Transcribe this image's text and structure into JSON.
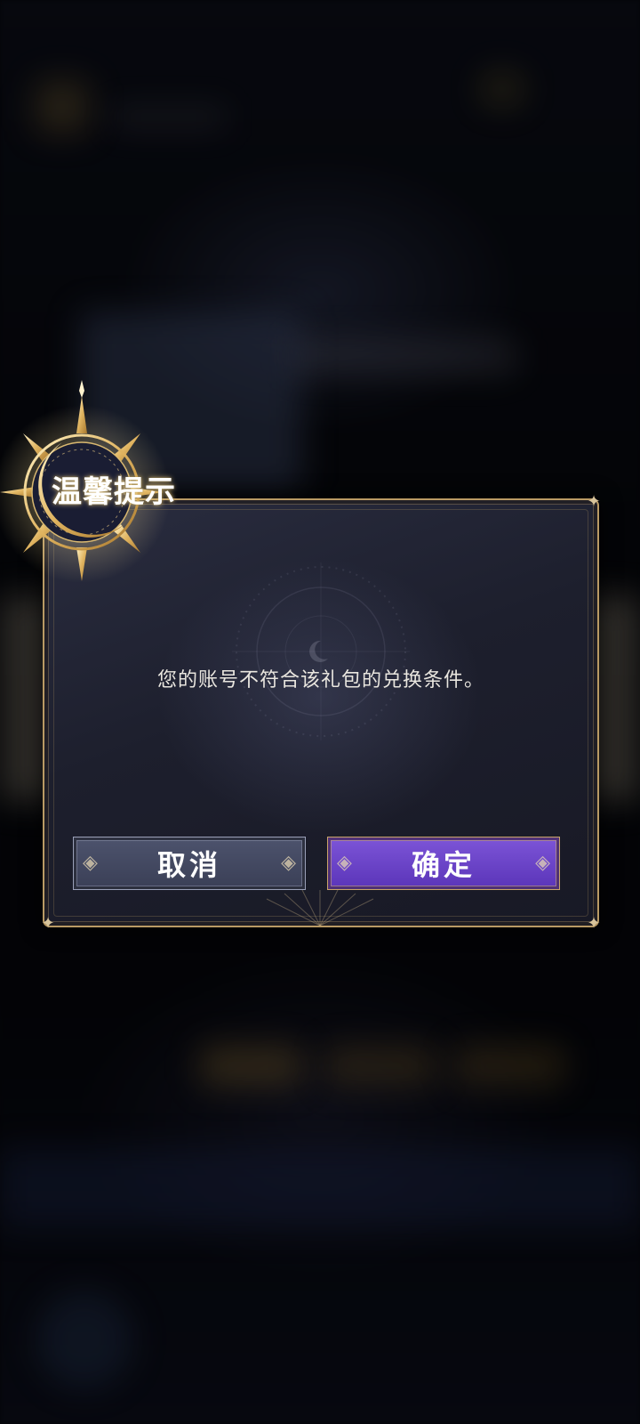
{
  "dialog": {
    "title": "温馨提示",
    "message": "您的账号不符合该礼包的兑换条件。",
    "cancel_label": "取消",
    "confirm_label": "确定"
  },
  "icons": {
    "emblem": "moon-sun-emblem-icon",
    "corner": "sparkle-star-icon",
    "compass": "star-compass-icon"
  },
  "colors": {
    "frame_gold": "#b99a64",
    "cancel_button": "#454a63",
    "confirm_button": "#6b45c9",
    "dialog_bg": "#1d1f2d",
    "message_text": "#e9e6df"
  }
}
